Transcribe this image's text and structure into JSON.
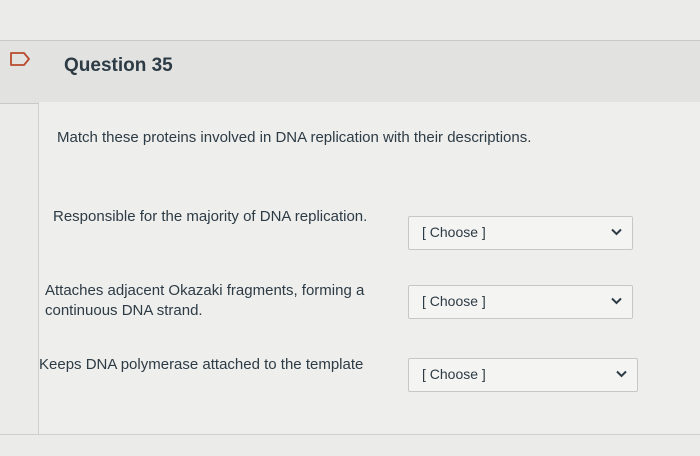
{
  "question": {
    "title": "Question 35",
    "instructions": "Match these proteins involved in DNA replication with their descriptions."
  },
  "matches": [
    {
      "prompt_lines": [
        "Responsible for the majority of DNA replication."
      ],
      "selected": "[ Choose ]"
    },
    {
      "prompt_lines": [
        "Attaches adjacent Okazaki fragments, forming a",
        "continuous DNA strand."
      ],
      "selected": "[ Choose ]"
    },
    {
      "prompt_lines": [
        "Keeps DNA polymerase attached to the template"
      ],
      "selected": "[ Choose ]"
    }
  ],
  "icons": {
    "flag": "flag-outline-icon",
    "dropdown": "chevron-down-icon"
  },
  "colors": {
    "text": "#2d3b45",
    "border": "#c6c8c8",
    "background": "#ebebea"
  }
}
